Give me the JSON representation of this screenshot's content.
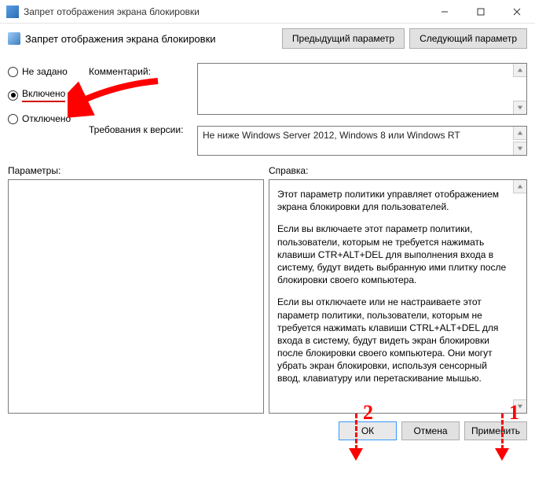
{
  "titlebar": {
    "title": "Запрет отображения экрана блокировки"
  },
  "header": {
    "title": "Запрет отображения экрана блокировки",
    "prev_button": "Предыдущий параметр",
    "next_button": "Следующий параметр"
  },
  "radios": {
    "not_configured": "Не задано",
    "enabled": "Включено",
    "disabled": "Отключено",
    "selected": "enabled"
  },
  "labels": {
    "comment": "Комментарий:",
    "requirements": "Требования к версии:",
    "parameters": "Параметры:",
    "help": "Справка:"
  },
  "requirements_text": "Не ниже Windows Server 2012, Windows 8 или Windows RT",
  "help_paragraphs": [
    "Этот параметр политики управляет отображением экрана блокировки для пользователей.",
    "Если вы включаете этот параметр политики, пользователи, которым не требуется нажимать клавиши CTR+ALT+DEL для выполнения входа в систему, будут видеть выбранную ими плитку после блокировки своего компьютера.",
    "Если вы отключаете или не настраиваете этот параметр политики, пользователи, которым не требуется нажимать клавиши CTRL+ALT+DEL для входа в систему, будут видеть экран блокировки после блокировки своего компьютера. Они могут убрать экран блокировки, используя сенсорный ввод, клавиатуру или перетаскивание мышью."
  ],
  "footer": {
    "ok": "ОК",
    "cancel": "Отмена",
    "apply": "Применить"
  },
  "annotations": {
    "num1": "1",
    "num2": "2"
  }
}
